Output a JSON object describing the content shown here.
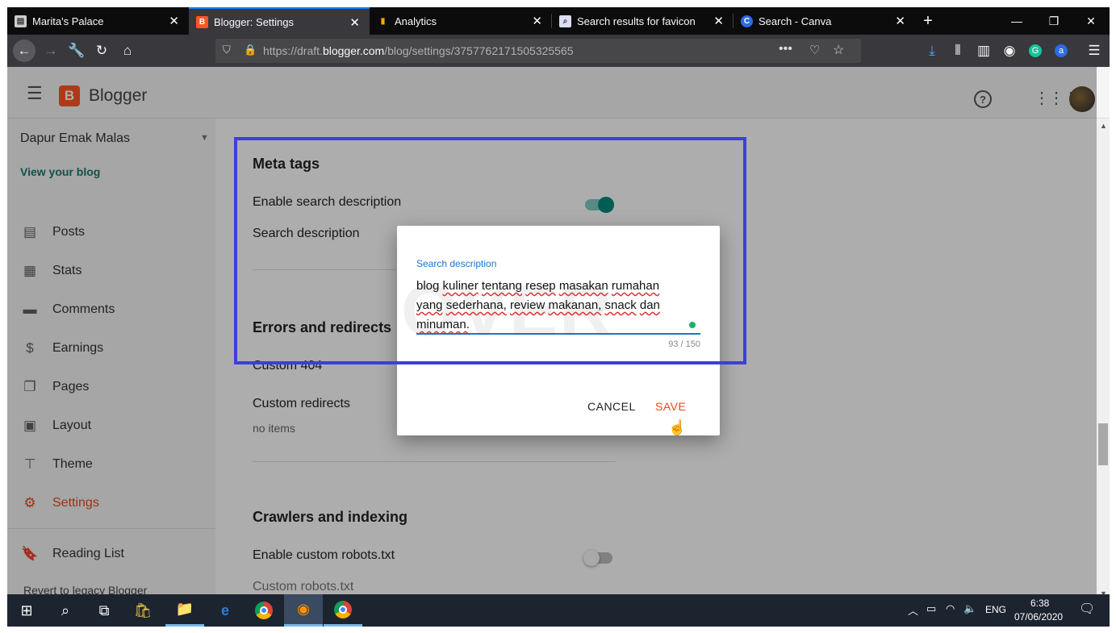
{
  "browser": {
    "tabs": [
      {
        "title": "Marita's Palace",
        "icon": "site-icon"
      },
      {
        "title": "Blogger: Settings",
        "icon": "blogger-icon"
      },
      {
        "title": "Analytics",
        "icon": "analytics-icon"
      },
      {
        "title": "Search results for favicon",
        "icon": "search-result-icon"
      },
      {
        "title": "Search - Canva",
        "icon": "canva-icon"
      }
    ],
    "new_tab": "+",
    "url_prefix": "https://draft.",
    "url_domain": "blogger.com",
    "url_path": "/blog/settings/3757762171505325565"
  },
  "blogger": {
    "app_title": "Blogger",
    "logo_letter": "B",
    "blog_name": "Dapur Emak Malas",
    "view_blog": "View your blog",
    "nav": [
      {
        "label": "Posts",
        "icon": "posts-icon"
      },
      {
        "label": "Stats",
        "icon": "stats-icon"
      },
      {
        "label": "Comments",
        "icon": "comments-icon"
      },
      {
        "label": "Earnings",
        "icon": "dollar-icon"
      },
      {
        "label": "Pages",
        "icon": "pages-icon"
      },
      {
        "label": "Layout",
        "icon": "layout-icon"
      },
      {
        "label": "Theme",
        "icon": "paint-roller-icon"
      },
      {
        "label": "Settings",
        "icon": "gear-icon"
      },
      {
        "label": "Reading List",
        "icon": "bookmark-icon"
      }
    ],
    "revert": "Revert to legacy Blogger",
    "accent_color": "#e64a19"
  },
  "settings": {
    "meta_tags": "Meta tags",
    "enable_search_description": "Enable search description",
    "search_description": "Search description",
    "errors_redirects": "Errors and redirects",
    "custom_404": "Custom 404",
    "custom_redirects": "Custom redirects",
    "no_items": "no items",
    "crawlers": "Crawlers and indexing",
    "enable_robots": "Enable custom robots.txt",
    "custom_robots": "Custom robots.txt"
  },
  "dialog": {
    "label": "Search description",
    "value_words": [
      "blog",
      "kuliner",
      "tentang",
      "resep",
      "masakan",
      "rumahan",
      "yang",
      "sederhana,",
      "review",
      "makanan,",
      "snack",
      "dan",
      "minuman."
    ],
    "count": "93 / 150",
    "cancel": "CANCEL",
    "save": "SAVE",
    "watermark": "OVER"
  },
  "taskbar": {
    "lang": "ENG",
    "time": "6:38",
    "date": "07/06/2020"
  }
}
